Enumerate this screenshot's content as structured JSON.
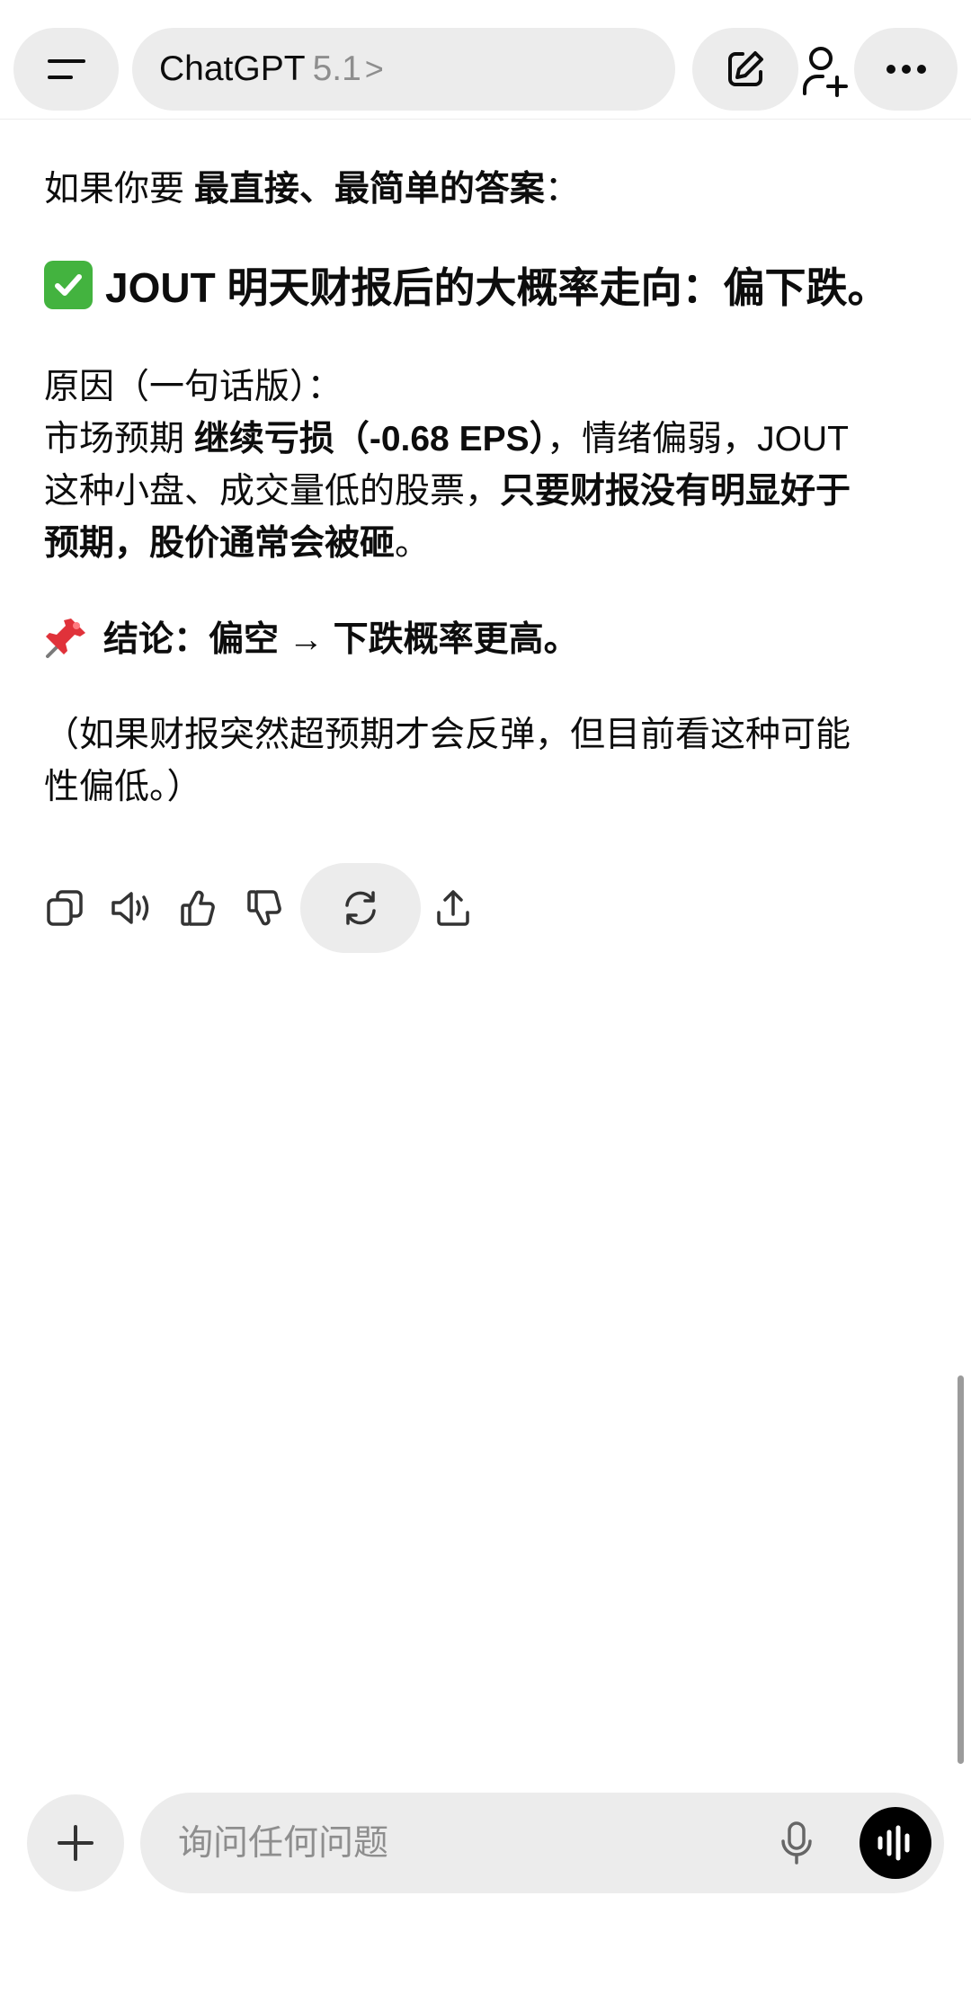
{
  "header": {
    "title": "ChatGPT",
    "version": "5.1",
    "chevron": ">",
    "icons": {
      "menu": "menu-icon",
      "edit": "edit-icon",
      "add_user": "add-user-icon",
      "more": "more-icon"
    }
  },
  "message": {
    "intro_prefix": "如果你要 ",
    "intro_bold": "最直接、最简单的答案",
    "intro_suffix": "：",
    "headline_emoji": "check-mark-emoji",
    "headline": "JOUT 明天财报后的大概率走向：偏下跌。",
    "reason_label": "原因（一句话版）：",
    "reason_1_prefix": "市场预期 ",
    "reason_1_bold": "继续亏损（-0.68 EPS）",
    "reason_1_suffix": "，情绪偏弱，JOUT",
    "reason_2_plain": "这种小盘、成交量低的股票，",
    "reason_2_bold": "只要财报没有明显好于",
    "reason_3_bold": "预期，股价通常会被砸",
    "reason_3_suffix": "。",
    "conclusion_emoji": "pushpin-emoji",
    "conclusion": "结论：偏空 → 下跌概率更高。",
    "note_1": "（如果财报突然超预期才会反弹，但目前看这种可能",
    "note_2": "性偏低。）"
  },
  "actions": [
    "copy-icon",
    "read-aloud-icon",
    "thumbs-up-icon",
    "thumbs-down-icon",
    "regenerate-icon",
    "share-icon"
  ],
  "composer": {
    "placeholder": "询问任何问题",
    "icons": {
      "plus": "plus-icon",
      "mic": "microphone-icon",
      "voice": "voice-mode-icon"
    }
  }
}
